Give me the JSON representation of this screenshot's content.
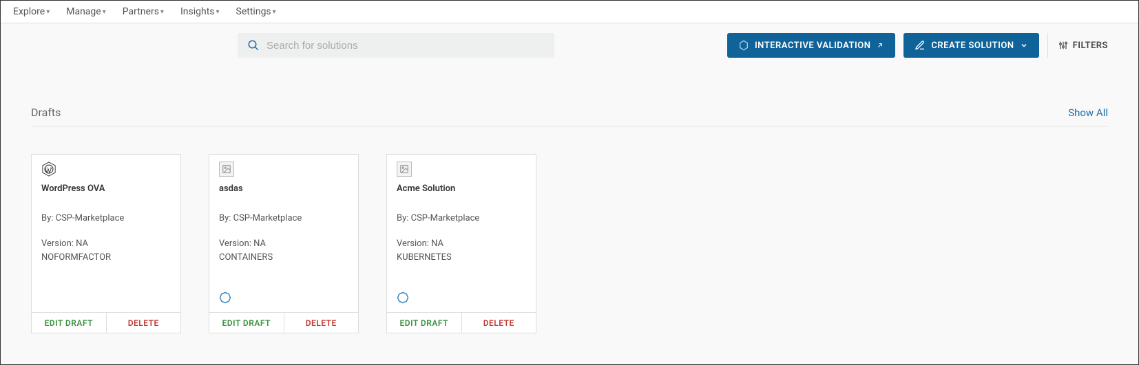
{
  "nav": {
    "items": [
      "Explore",
      "Manage",
      "Partners",
      "Insights",
      "Settings"
    ]
  },
  "toolbar": {
    "search_placeholder": "Search for solutions",
    "interactive_validation_label": "INTERACTIVE VALIDATION",
    "create_solution_label": "CREATE SOLUTION",
    "filters_label": "FILTERS"
  },
  "section": {
    "title": "Drafts",
    "show_all_label": "Show All"
  },
  "cards": [
    {
      "title": "WordPress OVA",
      "by": "By: CSP-Marketplace",
      "version": "Version: NA",
      "form_factor": "NOFORMFACTOR",
      "logo": "wordpress",
      "has_badge": false,
      "edit_label": "EDIT DRAFT",
      "delete_label": "DELETE"
    },
    {
      "title": "asdas",
      "by": "By: CSP-Marketplace",
      "version": "Version: NA",
      "form_factor": "CONTAINERS",
      "logo": "placeholder",
      "has_badge": true,
      "edit_label": "EDIT DRAFT",
      "delete_label": "DELETE"
    },
    {
      "title": "Acme Solution",
      "by": "By: CSP-Marketplace",
      "version": "Version: NA",
      "form_factor": "KUBERNETES",
      "logo": "placeholder",
      "has_badge": true,
      "edit_label": "EDIT DRAFT",
      "delete_label": "DELETE"
    }
  ]
}
